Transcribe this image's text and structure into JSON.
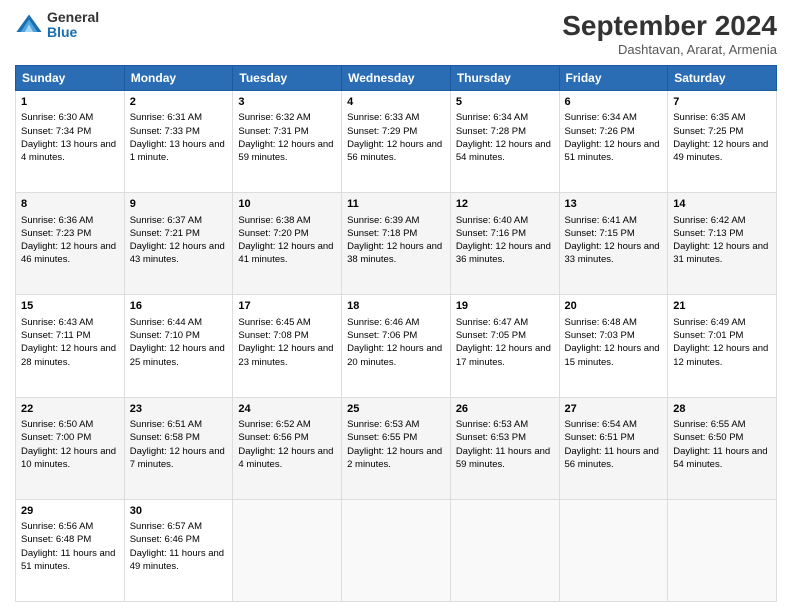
{
  "logo": {
    "general": "General",
    "blue": "Blue"
  },
  "header": {
    "title": "September 2024",
    "subtitle": "Dashtavan, Ararat, Armenia"
  },
  "weekdays": [
    "Sunday",
    "Monday",
    "Tuesday",
    "Wednesday",
    "Thursday",
    "Friday",
    "Saturday"
  ],
  "weeks": [
    [
      {
        "day": "1",
        "sunrise": "6:30 AM",
        "sunset": "7:34 PM",
        "daylight": "13 hours and 4 minutes."
      },
      {
        "day": "2",
        "sunrise": "6:31 AM",
        "sunset": "7:33 PM",
        "daylight": "13 hours and 1 minute."
      },
      {
        "day": "3",
        "sunrise": "6:32 AM",
        "sunset": "7:31 PM",
        "daylight": "12 hours and 59 minutes."
      },
      {
        "day": "4",
        "sunrise": "6:33 AM",
        "sunset": "7:29 PM",
        "daylight": "12 hours and 56 minutes."
      },
      {
        "day": "5",
        "sunrise": "6:34 AM",
        "sunset": "7:28 PM",
        "daylight": "12 hours and 54 minutes."
      },
      {
        "day": "6",
        "sunrise": "6:34 AM",
        "sunset": "7:26 PM",
        "daylight": "12 hours and 51 minutes."
      },
      {
        "day": "7",
        "sunrise": "6:35 AM",
        "sunset": "7:25 PM",
        "daylight": "12 hours and 49 minutes."
      }
    ],
    [
      {
        "day": "8",
        "sunrise": "6:36 AM",
        "sunset": "7:23 PM",
        "daylight": "12 hours and 46 minutes."
      },
      {
        "day": "9",
        "sunrise": "6:37 AM",
        "sunset": "7:21 PM",
        "daylight": "12 hours and 43 minutes."
      },
      {
        "day": "10",
        "sunrise": "6:38 AM",
        "sunset": "7:20 PM",
        "daylight": "12 hours and 41 minutes."
      },
      {
        "day": "11",
        "sunrise": "6:39 AM",
        "sunset": "7:18 PM",
        "daylight": "12 hours and 38 minutes."
      },
      {
        "day": "12",
        "sunrise": "6:40 AM",
        "sunset": "7:16 PM",
        "daylight": "12 hours and 36 minutes."
      },
      {
        "day": "13",
        "sunrise": "6:41 AM",
        "sunset": "7:15 PM",
        "daylight": "12 hours and 33 minutes."
      },
      {
        "day": "14",
        "sunrise": "6:42 AM",
        "sunset": "7:13 PM",
        "daylight": "12 hours and 31 minutes."
      }
    ],
    [
      {
        "day": "15",
        "sunrise": "6:43 AM",
        "sunset": "7:11 PM",
        "daylight": "12 hours and 28 minutes."
      },
      {
        "day": "16",
        "sunrise": "6:44 AM",
        "sunset": "7:10 PM",
        "daylight": "12 hours and 25 minutes."
      },
      {
        "day": "17",
        "sunrise": "6:45 AM",
        "sunset": "7:08 PM",
        "daylight": "12 hours and 23 minutes."
      },
      {
        "day": "18",
        "sunrise": "6:46 AM",
        "sunset": "7:06 PM",
        "daylight": "12 hours and 20 minutes."
      },
      {
        "day": "19",
        "sunrise": "6:47 AM",
        "sunset": "7:05 PM",
        "daylight": "12 hours and 17 minutes."
      },
      {
        "day": "20",
        "sunrise": "6:48 AM",
        "sunset": "7:03 PM",
        "daylight": "12 hours and 15 minutes."
      },
      {
        "day": "21",
        "sunrise": "6:49 AM",
        "sunset": "7:01 PM",
        "daylight": "12 hours and 12 minutes."
      }
    ],
    [
      {
        "day": "22",
        "sunrise": "6:50 AM",
        "sunset": "7:00 PM",
        "daylight": "12 hours and 10 minutes."
      },
      {
        "day": "23",
        "sunrise": "6:51 AM",
        "sunset": "6:58 PM",
        "daylight": "12 hours and 7 minutes."
      },
      {
        "day": "24",
        "sunrise": "6:52 AM",
        "sunset": "6:56 PM",
        "daylight": "12 hours and 4 minutes."
      },
      {
        "day": "25",
        "sunrise": "6:53 AM",
        "sunset": "6:55 PM",
        "daylight": "12 hours and 2 minutes."
      },
      {
        "day": "26",
        "sunrise": "6:53 AM",
        "sunset": "6:53 PM",
        "daylight": "11 hours and 59 minutes."
      },
      {
        "day": "27",
        "sunrise": "6:54 AM",
        "sunset": "6:51 PM",
        "daylight": "11 hours and 56 minutes."
      },
      {
        "day": "28",
        "sunrise": "6:55 AM",
        "sunset": "6:50 PM",
        "daylight": "11 hours and 54 minutes."
      }
    ],
    [
      {
        "day": "29",
        "sunrise": "6:56 AM",
        "sunset": "6:48 PM",
        "daylight": "11 hours and 51 minutes."
      },
      {
        "day": "30",
        "sunrise": "6:57 AM",
        "sunset": "6:46 PM",
        "daylight": "11 hours and 49 minutes."
      },
      null,
      null,
      null,
      null,
      null
    ]
  ]
}
